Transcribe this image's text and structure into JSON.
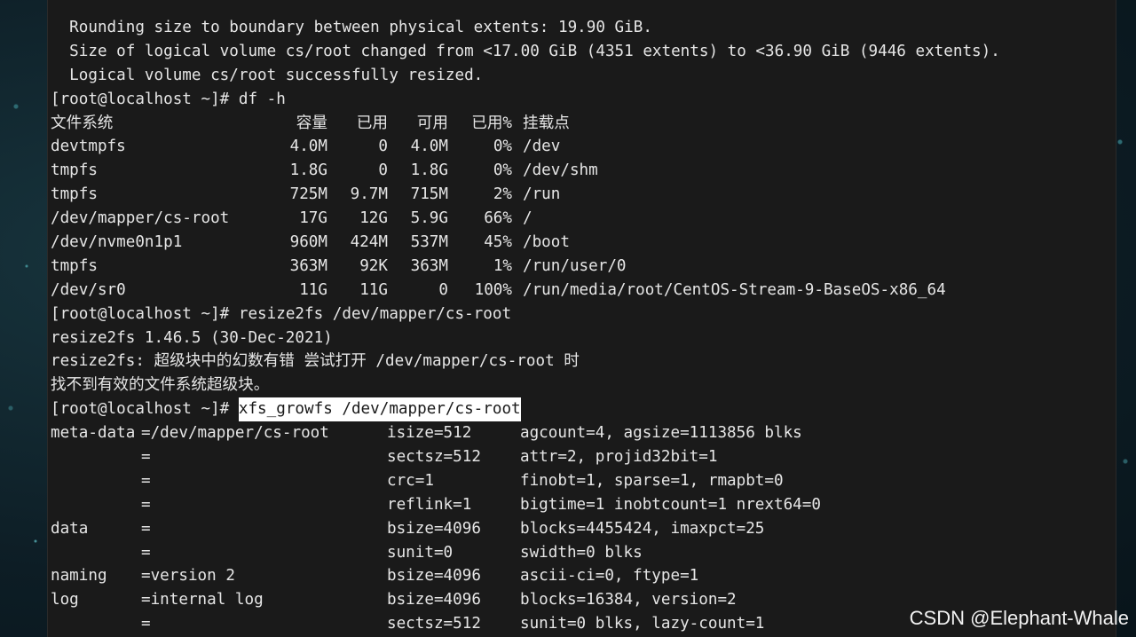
{
  "terminal": {
    "lvextend_output": [
      "  Rounding size to boundary between physical extents: 19.90 GiB.",
      "  Size of logical volume cs/root changed from <17.00 GiB (4351 extents) to <36.90 GiB (9446 extents).",
      "  Logical volume cs/root successfully resized."
    ],
    "df": {
      "prompt": "[root@localhost ~]# ",
      "command": "df -h",
      "headers": [
        "文件系统",
        "容量",
        "已用",
        "可用",
        "已用%",
        "挂载点"
      ],
      "rows": [
        [
          "devtmpfs",
          "4.0M",
          "0",
          "4.0M",
          "0%",
          "/dev"
        ],
        [
          "tmpfs",
          "1.8G",
          "0",
          "1.8G",
          "0%",
          "/dev/shm"
        ],
        [
          "tmpfs",
          "725M",
          "9.7M",
          "715M",
          "2%",
          "/run"
        ],
        [
          "/dev/mapper/cs-root",
          "17G",
          "12G",
          "5.9G",
          "66%",
          "/"
        ],
        [
          "/dev/nvme0n1p1",
          "960M",
          "424M",
          "537M",
          "45%",
          "/boot"
        ],
        [
          "tmpfs",
          "363M",
          "92K",
          "363M",
          "1%",
          "/run/user/0"
        ],
        [
          "/dev/sr0",
          "11G",
          "11G",
          "0",
          "100%",
          "/run/media/root/CentOS-Stream-9-BaseOS-x86_64"
        ]
      ]
    },
    "resize2fs": {
      "prompt": "[root@localhost ~]# ",
      "command": "resize2fs /dev/mapper/cs-root",
      "output": [
        "resize2fs 1.46.5 (30-Dec-2021)",
        "resize2fs: 超级块中的幻数有错 尝试打开 /dev/mapper/cs-root 时",
        "找不到有效的文件系统超级块。"
      ]
    },
    "xfs_growfs": {
      "prompt": "[root@localhost ~]# ",
      "command": "xfs_growfs /dev/mapper/cs-root",
      "rows": [
        [
          "meta-data",
          "=/dev/mapper/cs-root",
          "isize=512",
          "agcount=4, agsize=1113856 blks"
        ],
        [
          "",
          "=",
          "sectsz=512",
          "attr=2, projid32bit=1"
        ],
        [
          "",
          "=",
          "crc=1",
          "finobt=1, sparse=1, rmapbt=0"
        ],
        [
          "",
          "=",
          "reflink=1",
          "bigtime=1 inobtcount=1 nrext64=0"
        ],
        [
          "data",
          "=",
          "bsize=4096",
          "blocks=4455424, imaxpct=25"
        ],
        [
          "",
          "=",
          "sunit=0",
          "swidth=0 blks"
        ],
        [
          "naming",
          "=version 2",
          "bsize=4096",
          "ascii-ci=0, ftype=1"
        ],
        [
          "log",
          "=internal log",
          "bsize=4096",
          "blocks=16384, version=2"
        ],
        [
          "",
          "=",
          "sectsz=512",
          "sunit=0 blks, lazy-count=1"
        ]
      ]
    }
  },
  "watermark": "CSDN @Elephant-Whale"
}
